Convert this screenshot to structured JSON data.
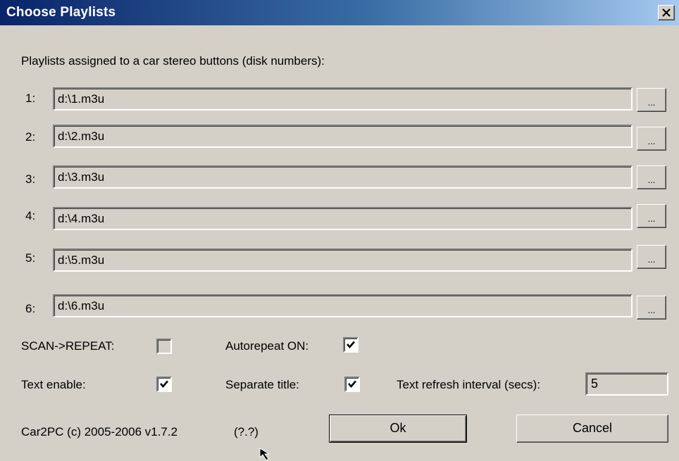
{
  "window": {
    "title": "Choose Playlists"
  },
  "header_text": "Playlists assigned to a car stereo buttons (disk numbers):",
  "playlists": [
    {
      "label": "1:",
      "path": "d:\\1.m3u",
      "browse_label": "..."
    },
    {
      "label": "2:",
      "path": "d:\\2.m3u",
      "browse_label": "..."
    },
    {
      "label": "3:",
      "path": "d:\\3.m3u",
      "browse_label": "..."
    },
    {
      "label": "4:",
      "path": "d:\\4.m3u",
      "browse_label": "..."
    },
    {
      "label": "5:",
      "path": "d:\\5.m3u",
      "browse_label": "..."
    },
    {
      "label": "6:",
      "path": "d:\\6.m3u",
      "browse_label": "..."
    }
  ],
  "options": {
    "scan_repeat": {
      "label": "SCAN->REPEAT:",
      "checked": false
    },
    "autorepeat": {
      "label": "Autorepeat ON:",
      "checked": true
    },
    "text_enable": {
      "label": "Text enable:",
      "checked": true
    },
    "separate_title": {
      "label": "Separate title:",
      "checked": true
    },
    "refresh_interval": {
      "label": "Text refresh interval (secs):",
      "value": "5"
    }
  },
  "footer": {
    "version": "Car2PC (c) 2005-2006 v1.7.2",
    "help_link": "(?.?)",
    "ok_label": "Ok",
    "cancel_label": "Cancel"
  },
  "colors": {
    "dialog_bg": "#d4d0c8",
    "title_start": "#0a246a",
    "title_end": "#a6caf0"
  }
}
